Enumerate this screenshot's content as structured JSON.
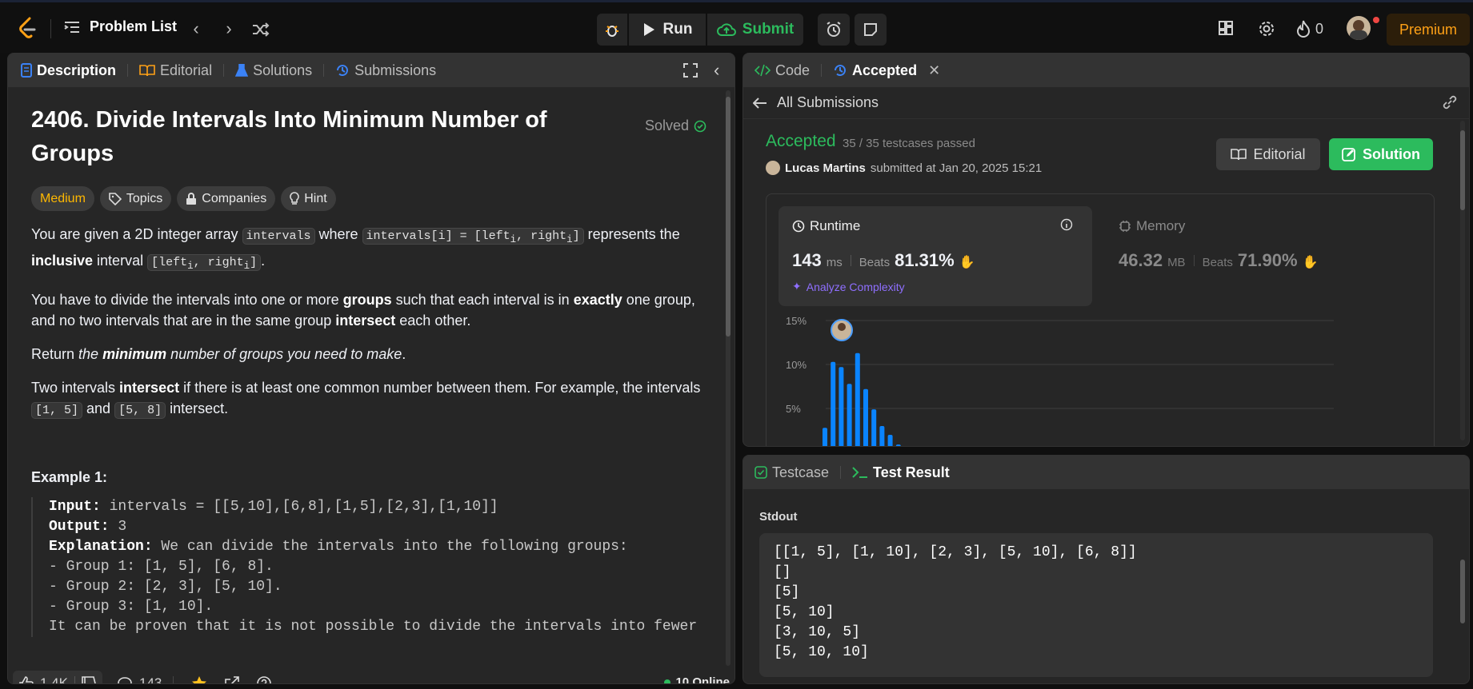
{
  "header": {
    "problem_list": "Problem List",
    "run": "Run",
    "submit": "Submit",
    "streak_count": "0",
    "premium": "Premium"
  },
  "left": {
    "tabs": [
      {
        "label": "Description",
        "icon": "doc-icon"
      },
      {
        "label": "Editorial",
        "icon": "book-icon"
      },
      {
        "label": "Solutions",
        "icon": "flask-icon"
      },
      {
        "label": "Submissions",
        "icon": "history-icon"
      }
    ],
    "title": "2406. Divide Intervals Into Minimum Number of Groups",
    "solved": "Solved",
    "chips": {
      "difficulty": "Medium",
      "topics": "Topics",
      "companies": "Companies",
      "hint": "Hint"
    },
    "example_title": "Example 1:",
    "example": {
      "input_label": "Input:",
      "input": " intervals = [[5,10],[6,8],[1,5],[2,3],[1,10]]",
      "output_label": "Output:",
      "output": " 3",
      "explanation_label": "Explanation:",
      "explanation": " We can divide the intervals into the following groups:",
      "g1": "- Group 1: [1, 5], [6, 8].",
      "g2": "- Group 2: [2, 3], [5, 10].",
      "g3": "- Group 3: [1, 10].",
      "last": "It can be proven that it is not possible to divide the intervals into fewer"
    },
    "footer": {
      "likes": "1.4K",
      "comments": "143",
      "online": "10 Online"
    }
  },
  "right": {
    "tabs": [
      {
        "label": "Code",
        "icon": "code-icon"
      },
      {
        "label": "Accepted",
        "icon": "history-icon"
      }
    ],
    "all_submissions": "All Submissions",
    "status": "Accepted",
    "passed": "35 / 35 testcases passed",
    "user": "Lucas Martins",
    "submitted_at": "submitted at Jan 20, 2025 15:21",
    "editorial_btn": "Editorial",
    "solution_btn": "Solution",
    "runtime": {
      "label": "Runtime",
      "value": "143",
      "unit": "ms",
      "beats_label": "Beats",
      "beats": "81.31%",
      "analyze": "Analyze Complexity"
    },
    "memory": {
      "label": "Memory",
      "value": "46.32",
      "unit": "MB",
      "beats_label": "Beats",
      "beats": "71.90%"
    }
  },
  "chart_data": {
    "type": "bar",
    "yticks": [
      "15%",
      "10%",
      "5%"
    ],
    "ylim": [
      0,
      15
    ],
    "values": [
      2.8,
      10.3,
      9.7,
      7.8,
      11.3,
      7.2,
      4.9,
      3.0,
      2.0,
      0.9,
      0.3
    ],
    "color": "#0a84ff"
  },
  "testpanel": {
    "tabs": [
      {
        "label": "Testcase",
        "icon": "check-box-icon"
      },
      {
        "label": "Test Result",
        "icon": "terminal-icon"
      }
    ],
    "stdout_label": "Stdout",
    "stdout_lines": [
      "[[1, 5], [1, 10], [2, 3], [5, 10], [6, 8]]",
      "[]",
      "[5]",
      "[5, 10]",
      "[3, 10, 5]",
      "[5, 10, 10]"
    ]
  }
}
